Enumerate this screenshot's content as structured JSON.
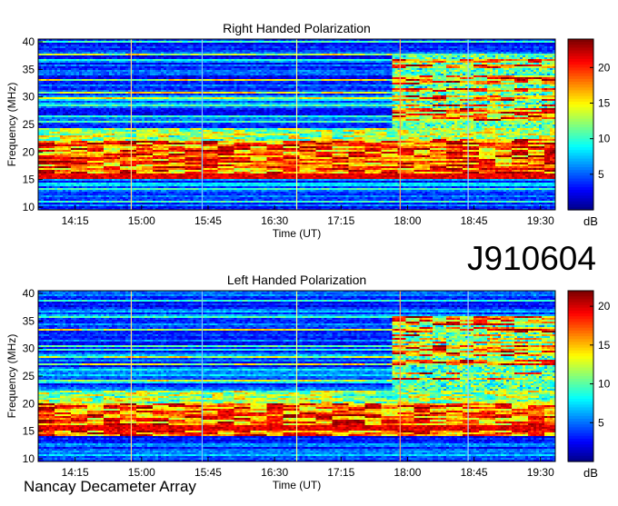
{
  "figure": {
    "observation_id": "J910604",
    "instrument": "Nancay Decameter Array"
  },
  "colors": {
    "colormap": [
      "#00007f",
      "#0000ff",
      "#007fff",
      "#00ffff",
      "#7fff7f",
      "#ffff00",
      "#ff7f00",
      "#ff0000",
      "#7f0000"
    ]
  },
  "chart_data": [
    {
      "type": "heatmap",
      "title": "Right Handed Polarization",
      "xlabel": "Time (UT)",
      "ylabel": "Frequency (MHz)",
      "xticks": [
        "14:15",
        "15:00",
        "15:45",
        "16:30",
        "17:15",
        "18:00",
        "18:45",
        "19:30"
      ],
      "xtick_minutes": [
        855,
        900,
        945,
        990,
        1035,
        1080,
        1125,
        1170
      ],
      "xlim_minutes": [
        830,
        1180
      ],
      "yticks": [
        10,
        15,
        20,
        25,
        30,
        35,
        40
      ],
      "ylim": [
        9.5,
        40.5
      ],
      "colorbar": {
        "label": "dB",
        "ticks": [
          5,
          10,
          15,
          20
        ],
        "range": [
          0,
          24
        ]
      },
      "emission": {
        "strong_band_mhz": [
          15,
          22
        ],
        "late_onset_time": "17:50",
        "late_band_mhz": [
          22,
          38
        ]
      }
    },
    {
      "type": "heatmap",
      "title": "Left Handed Polarization",
      "xlabel": "Time (UT)",
      "ylabel": "Frequency (MHz)",
      "xticks": [
        "14:15",
        "15:00",
        "15:45",
        "16:30",
        "17:15",
        "18:00",
        "18:45",
        "19:30"
      ],
      "xtick_minutes": [
        855,
        900,
        945,
        990,
        1035,
        1080,
        1125,
        1170
      ],
      "xlim_minutes": [
        830,
        1180
      ],
      "yticks": [
        10,
        15,
        20,
        25,
        30,
        35,
        40
      ],
      "ylim": [
        9.5,
        40.5
      ],
      "colorbar": {
        "label": "dB",
        "ticks": [
          5,
          10,
          15,
          20
        ],
        "range": [
          0,
          22
        ]
      },
      "emission": {
        "strong_band_mhz": [
          14,
          20
        ],
        "late_onset_time": "17:50",
        "late_band_mhz": [
          22,
          36
        ]
      }
    }
  ]
}
